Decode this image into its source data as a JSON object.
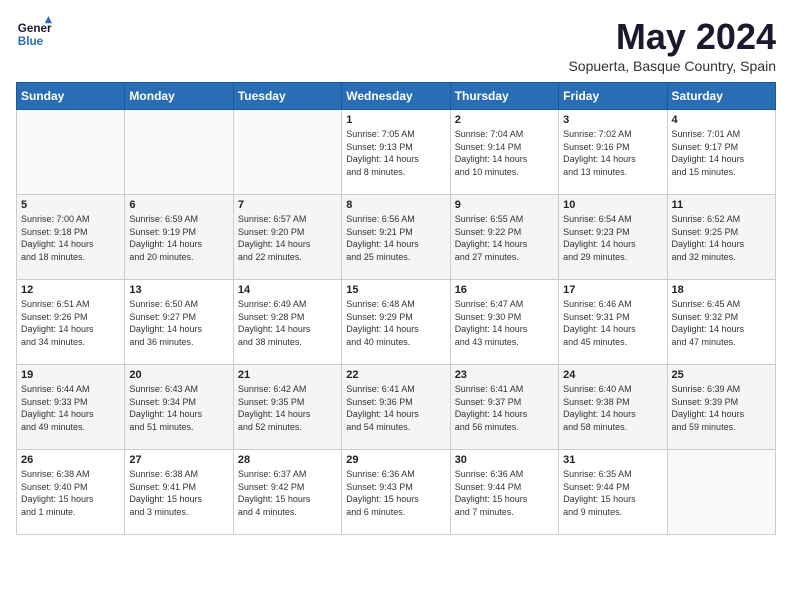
{
  "header": {
    "logo_general": "General",
    "logo_blue": "Blue",
    "title": "May 2024",
    "location": "Sopuerta, Basque Country, Spain"
  },
  "days_of_week": [
    "Sunday",
    "Monday",
    "Tuesday",
    "Wednesday",
    "Thursday",
    "Friday",
    "Saturday"
  ],
  "weeks": [
    [
      {
        "day": "",
        "content": ""
      },
      {
        "day": "",
        "content": ""
      },
      {
        "day": "",
        "content": ""
      },
      {
        "day": "1",
        "content": "Sunrise: 7:05 AM\nSunset: 9:13 PM\nDaylight: 14 hours\nand 8 minutes."
      },
      {
        "day": "2",
        "content": "Sunrise: 7:04 AM\nSunset: 9:14 PM\nDaylight: 14 hours\nand 10 minutes."
      },
      {
        "day": "3",
        "content": "Sunrise: 7:02 AM\nSunset: 9:16 PM\nDaylight: 14 hours\nand 13 minutes."
      },
      {
        "day": "4",
        "content": "Sunrise: 7:01 AM\nSunset: 9:17 PM\nDaylight: 14 hours\nand 15 minutes."
      }
    ],
    [
      {
        "day": "5",
        "content": "Sunrise: 7:00 AM\nSunset: 9:18 PM\nDaylight: 14 hours\nand 18 minutes."
      },
      {
        "day": "6",
        "content": "Sunrise: 6:59 AM\nSunset: 9:19 PM\nDaylight: 14 hours\nand 20 minutes."
      },
      {
        "day": "7",
        "content": "Sunrise: 6:57 AM\nSunset: 9:20 PM\nDaylight: 14 hours\nand 22 minutes."
      },
      {
        "day": "8",
        "content": "Sunrise: 6:56 AM\nSunset: 9:21 PM\nDaylight: 14 hours\nand 25 minutes."
      },
      {
        "day": "9",
        "content": "Sunrise: 6:55 AM\nSunset: 9:22 PM\nDaylight: 14 hours\nand 27 minutes."
      },
      {
        "day": "10",
        "content": "Sunrise: 6:54 AM\nSunset: 9:23 PM\nDaylight: 14 hours\nand 29 minutes."
      },
      {
        "day": "11",
        "content": "Sunrise: 6:52 AM\nSunset: 9:25 PM\nDaylight: 14 hours\nand 32 minutes."
      }
    ],
    [
      {
        "day": "12",
        "content": "Sunrise: 6:51 AM\nSunset: 9:26 PM\nDaylight: 14 hours\nand 34 minutes."
      },
      {
        "day": "13",
        "content": "Sunrise: 6:50 AM\nSunset: 9:27 PM\nDaylight: 14 hours\nand 36 minutes."
      },
      {
        "day": "14",
        "content": "Sunrise: 6:49 AM\nSunset: 9:28 PM\nDaylight: 14 hours\nand 38 minutes."
      },
      {
        "day": "15",
        "content": "Sunrise: 6:48 AM\nSunset: 9:29 PM\nDaylight: 14 hours\nand 40 minutes."
      },
      {
        "day": "16",
        "content": "Sunrise: 6:47 AM\nSunset: 9:30 PM\nDaylight: 14 hours\nand 43 minutes."
      },
      {
        "day": "17",
        "content": "Sunrise: 6:46 AM\nSunset: 9:31 PM\nDaylight: 14 hours\nand 45 minutes."
      },
      {
        "day": "18",
        "content": "Sunrise: 6:45 AM\nSunset: 9:32 PM\nDaylight: 14 hours\nand 47 minutes."
      }
    ],
    [
      {
        "day": "19",
        "content": "Sunrise: 6:44 AM\nSunset: 9:33 PM\nDaylight: 14 hours\nand 49 minutes."
      },
      {
        "day": "20",
        "content": "Sunrise: 6:43 AM\nSunset: 9:34 PM\nDaylight: 14 hours\nand 51 minutes."
      },
      {
        "day": "21",
        "content": "Sunrise: 6:42 AM\nSunset: 9:35 PM\nDaylight: 14 hours\nand 52 minutes."
      },
      {
        "day": "22",
        "content": "Sunrise: 6:41 AM\nSunset: 9:36 PM\nDaylight: 14 hours\nand 54 minutes."
      },
      {
        "day": "23",
        "content": "Sunrise: 6:41 AM\nSunset: 9:37 PM\nDaylight: 14 hours\nand 56 minutes."
      },
      {
        "day": "24",
        "content": "Sunrise: 6:40 AM\nSunset: 9:38 PM\nDaylight: 14 hours\nand 58 minutes."
      },
      {
        "day": "25",
        "content": "Sunrise: 6:39 AM\nSunset: 9:39 PM\nDaylight: 14 hours\nand 59 minutes."
      }
    ],
    [
      {
        "day": "26",
        "content": "Sunrise: 6:38 AM\nSunset: 9:40 PM\nDaylight: 15 hours\nand 1 minute."
      },
      {
        "day": "27",
        "content": "Sunrise: 6:38 AM\nSunset: 9:41 PM\nDaylight: 15 hours\nand 3 minutes."
      },
      {
        "day": "28",
        "content": "Sunrise: 6:37 AM\nSunset: 9:42 PM\nDaylight: 15 hours\nand 4 minutes."
      },
      {
        "day": "29",
        "content": "Sunrise: 6:36 AM\nSunset: 9:43 PM\nDaylight: 15 hours\nand 6 minutes."
      },
      {
        "day": "30",
        "content": "Sunrise: 6:36 AM\nSunset: 9:44 PM\nDaylight: 15 hours\nand 7 minutes."
      },
      {
        "day": "31",
        "content": "Sunrise: 6:35 AM\nSunset: 9:44 PM\nDaylight: 15 hours\nand 9 minutes."
      },
      {
        "day": "",
        "content": ""
      }
    ]
  ]
}
